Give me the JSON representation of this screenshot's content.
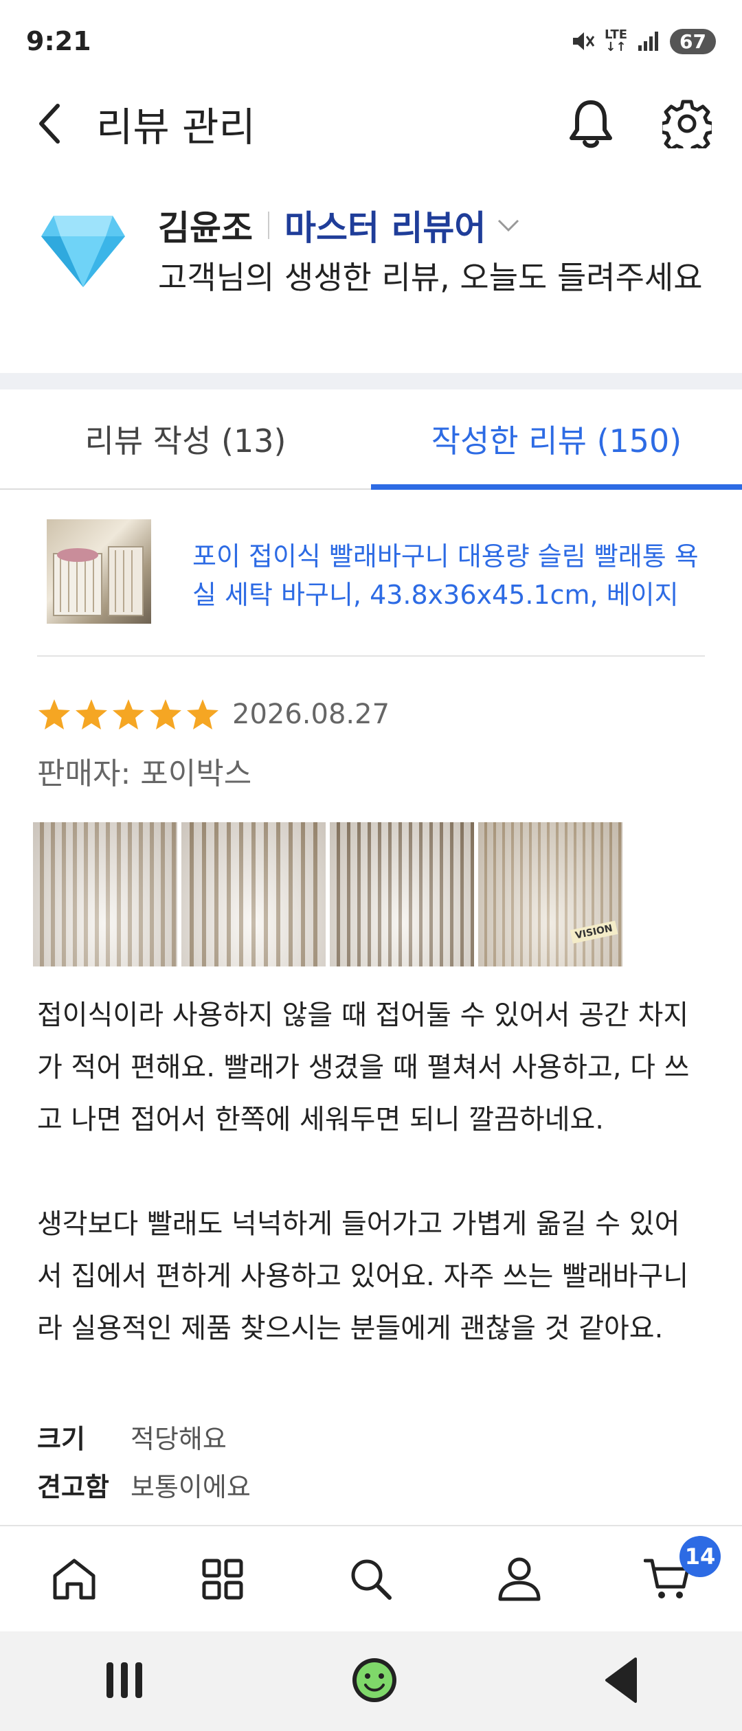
{
  "status_bar": {
    "time": "9:21",
    "network": "LTE",
    "battery": "67"
  },
  "header": {
    "title": "리뷰 관리"
  },
  "profile": {
    "name": "김윤조",
    "grade": "마스터 리뷰어",
    "greeting": "고객님의 생생한 리뷰, 오늘도 들려주세요"
  },
  "tabs": [
    {
      "label": "리뷰 작성 (13)",
      "active": false
    },
    {
      "label": "작성한 리뷰 (150)",
      "active": true
    }
  ],
  "product": {
    "name": "포이 접이식 빨래바구니 대용량 슬림 빨래통 욕실 세탁 바구니, 43.8x36x45.1cm, 베이지"
  },
  "review": {
    "rating": 5,
    "date": "2026.08.27",
    "seller": "판매자: 포이박스",
    "paragraphs": [
      "접이식이라 사용하지 않을 때 접어둘 수 있어서 공간 차지가 적어 편해요. 빨래가 생겼을 때 펼쳐서 사용하고, 다 쓰고 나면 접어서 한쪽에 세워두면 되니 깔끔하네요.",
      "생각보다 빨래도 넉넉하게 들어가고 가볍게 옮길 수 있어서 집에서 편하게 사용하고 있어요. 자주 쓰는 빨래바구니라 실용적인 제품 찾으시는 분들에게 괜찮을 것 같아요."
    ],
    "attributes": [
      {
        "key": "크기",
        "value": "적당해요"
      },
      {
        "key": "견고함",
        "value": "보통이에요"
      }
    ],
    "photo_text": "VISION"
  },
  "bottom_nav": {
    "cart_count": "14"
  },
  "colors": {
    "accent": "#2d6be4",
    "grade": "#1f3d99",
    "star": "#f5a623"
  }
}
